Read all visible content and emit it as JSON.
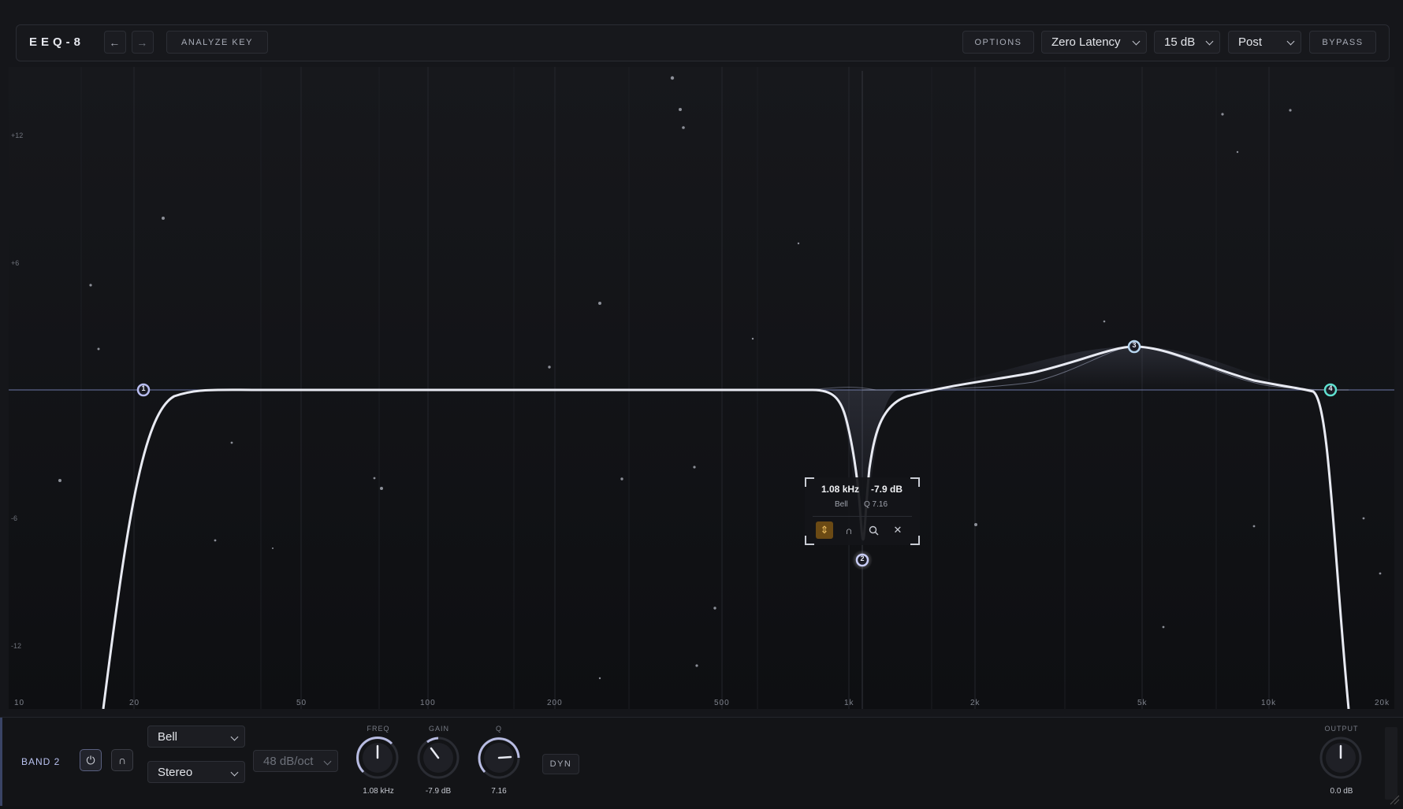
{
  "app": {
    "title": "EEQ-8"
  },
  "toolbar": {
    "undo_icon": "arrow-left-icon",
    "redo_icon": "arrow-right-icon",
    "analyze_label": "ANALYZE KEY",
    "options_label": "OPTIONS",
    "latency_value": "Zero Latency",
    "range_value": "15 dB",
    "mode_value": "Post",
    "bypass_label": "BYPASS"
  },
  "graph": {
    "x_ticks": [
      "10",
      "20",
      "50",
      "100",
      "200",
      "500",
      "1k",
      "2k",
      "5k",
      "10k",
      "20k"
    ],
    "y_ticks": [
      "+12",
      "+6",
      "-6",
      "-12"
    ],
    "bands": [
      {
        "id": "1",
        "label": "1",
        "type": "Low Cut"
      },
      {
        "id": "2",
        "label": "2",
        "type": "Bell"
      },
      {
        "id": "3",
        "label": "3",
        "type": "Bell"
      },
      {
        "id": "4",
        "label": "4",
        "type": "High Cut"
      }
    ]
  },
  "popup": {
    "freq": "1.08 kHz",
    "gain": "-7.9 dB",
    "type": "Bell",
    "q": "Q 7.16",
    "icons": [
      "swap-icon",
      "headphones-icon",
      "search-icon",
      "close-icon"
    ]
  },
  "panel": {
    "band_label": "BAND 2",
    "type_value": "Bell",
    "channel_value": "Stereo",
    "slope_value": "48 dB/oct",
    "freq_label": "FREQ",
    "freq_value": "1.08 kHz",
    "gain_label": "GAIN",
    "gain_value": "-7.9 dB",
    "q_label": "Q",
    "q_value": "7.16",
    "dyn_label": "DYN",
    "output_label": "OUTPUT",
    "output_value": "0.0 dB"
  },
  "colors": {
    "accent": "#c8ccf5",
    "band4": "#5fe0d0",
    "solo_active": "#e0a030"
  }
}
